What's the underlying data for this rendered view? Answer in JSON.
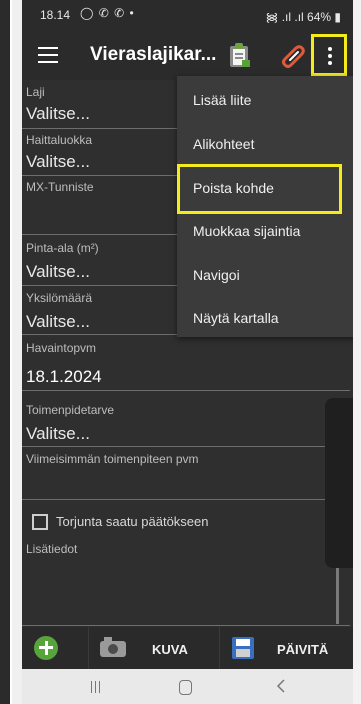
{
  "status_bar": {
    "time": "18.14",
    "icons": "◯ ✆ ✆ •",
    "right": "᯼ .ıl .ıl 64% ▮"
  },
  "toolbar": {
    "title": "Vieraslajikar...",
    "menu_icon": "hamburger-icon",
    "clipboard_icon": "clipboard-icon",
    "attach_icon": "paperclip-icon",
    "more_icon": "more-vertical-icon",
    "highlight_color": "#f2ec1c"
  },
  "form": {
    "laji": {
      "label": "Laji",
      "value": "Valitse..."
    },
    "haittaluokka": {
      "label": "Haittaluokka",
      "value": "Valitse..."
    },
    "mx_tunniste": {
      "label": "MX-Tunniste",
      "value": ""
    },
    "pinta_ala": {
      "label": "Pinta-ala (m²)",
      "value": "Valitse..."
    },
    "yksilomaara": {
      "label": "Yksilömäärä",
      "value": "Valitse..."
    },
    "havaintopvm": {
      "label": "Havaintopvm",
      "value": "18.1.2024"
    },
    "toimenpidetarve": {
      "label": "Toimenpidetarve",
      "value": "Valitse..."
    },
    "viimeisimman_pvm": {
      "label": "Viimeisimmän toimenpiteen pvm",
      "value": ""
    },
    "torjunta": {
      "label": "Torjunta saatu päätökseen",
      "checked": false
    },
    "lisatiedot": {
      "label": "Lisätiedot",
      "value": ""
    }
  },
  "menu": {
    "items": [
      {
        "label": "Lisää liite"
      },
      {
        "label": "Alikohteet"
      },
      {
        "label": "Poista kohde",
        "highlighted": true
      },
      {
        "label": "Muokkaa sijaintia"
      },
      {
        "label": "Navigoi"
      },
      {
        "label": "Näytä kartalla"
      }
    ]
  },
  "bottom_bar": {
    "add_icon": "plus-circle-icon",
    "camera_icon": "camera-icon",
    "kuva_label": "KUVA",
    "save_icon": "floppy-disk-icon",
    "paivita_label": "PÄIVITÄ",
    "add_color": "#57a53a"
  },
  "navbar": {
    "recent": "recent-apps-icon",
    "home": "home-icon",
    "back": "back-icon"
  }
}
